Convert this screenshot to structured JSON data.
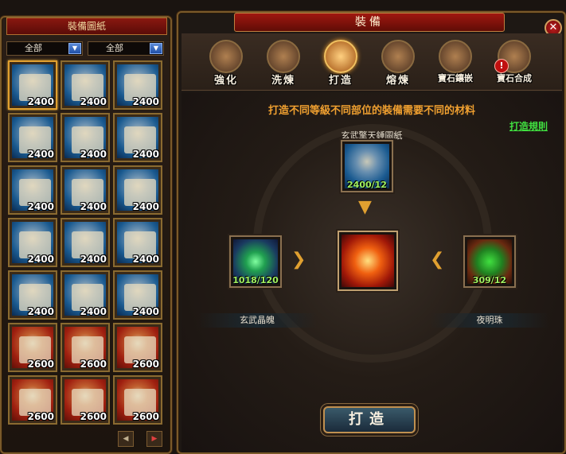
{
  "left": {
    "title": "裝備圖紙",
    "filter1": "全部",
    "filter2": "全部",
    "items": [
      {
        "value": "2400",
        "color": "blue"
      },
      {
        "value": "2400",
        "color": "blue"
      },
      {
        "value": "2400",
        "color": "blue"
      },
      {
        "value": "2400",
        "color": "blue"
      },
      {
        "value": "2400",
        "color": "blue"
      },
      {
        "value": "2400",
        "color": "blue"
      },
      {
        "value": "2400",
        "color": "blue"
      },
      {
        "value": "2400",
        "color": "blue"
      },
      {
        "value": "2400",
        "color": "blue"
      },
      {
        "value": "2400",
        "color": "blue"
      },
      {
        "value": "2400",
        "color": "blue"
      },
      {
        "value": "2400",
        "color": "blue"
      },
      {
        "value": "2400",
        "color": "blue"
      },
      {
        "value": "2400",
        "color": "blue"
      },
      {
        "value": "2400",
        "color": "blue"
      },
      {
        "value": "2600",
        "color": "red"
      },
      {
        "value": "2600",
        "color": "red"
      },
      {
        "value": "2600",
        "color": "red"
      },
      {
        "value": "2600",
        "color": "red"
      },
      {
        "value": "2600",
        "color": "red"
      },
      {
        "value": "2600",
        "color": "red"
      }
    ],
    "prev": "◀",
    "next": "▶"
  },
  "right": {
    "title": "裝備",
    "close": "✕",
    "tabs": [
      "強化",
      "洗煉",
      "打造",
      "熔煉",
      "寶石鑲嵌",
      "寶石合成"
    ],
    "alert": "!",
    "note": "打造不同等級不同部位的裝備需要不同的材料",
    "rule": "打造規則",
    "blueprint_name": "玄武擎天錘圖紙",
    "blueprint_count": "2400/12",
    "mat1_count": "1018/120",
    "mat1_name": "玄武晶魄",
    "mat2_count": "309/12",
    "mat2_name": "夜明珠",
    "forge": "打造"
  }
}
